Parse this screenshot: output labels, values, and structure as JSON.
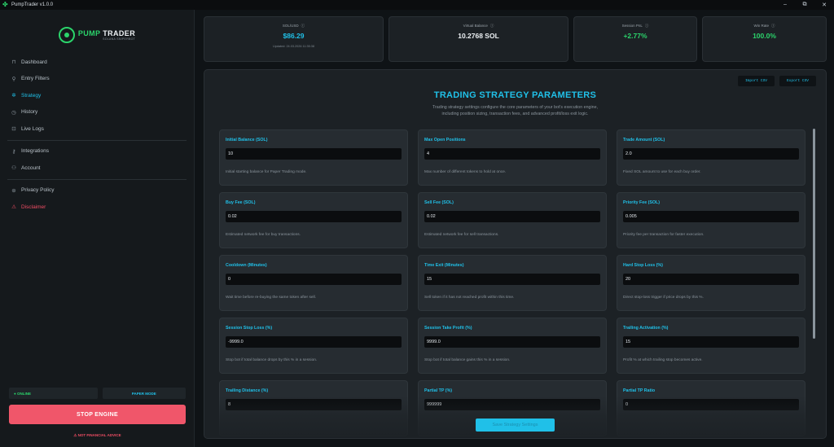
{
  "window": {
    "title": "PumpTrader v1.0.0",
    "controls": [
      "–",
      "⧉",
      "✕"
    ]
  },
  "brand": {
    "name_part1": "PUMP",
    "name_part2": " TRADER",
    "tagline": "SOLANA SNIPERBOT"
  },
  "sidebar": {
    "items": [
      {
        "label": "Dashboard",
        "icon": "dashboard-icon",
        "glyph": "⊓"
      },
      {
        "label": "Entry Filters",
        "icon": "filter-icon",
        "glyph": "⚲"
      },
      {
        "label": "Strategy",
        "icon": "gear-icon",
        "glyph": "✲"
      },
      {
        "label": "History",
        "icon": "clock-icon",
        "glyph": "◷"
      },
      {
        "label": "Live Logs",
        "icon": "log-icon",
        "glyph": "⊡"
      },
      {
        "label": "Integrations",
        "icon": "plug-icon",
        "glyph": "⚷"
      },
      {
        "label": "Account",
        "icon": "user-icon",
        "glyph": "⚇"
      },
      {
        "label": "Privacy Policy",
        "icon": "lock-icon",
        "glyph": "⊛"
      },
      {
        "label": "Disclaimer",
        "icon": "warning-icon",
        "glyph": "⚠"
      }
    ],
    "online_label": "● ONLINE",
    "mode_label": "PAPER MODE",
    "stop_label": "STOP ENGINE",
    "footer_note": "⚠ NOT FINANCIAL ADVICE"
  },
  "stats": [
    {
      "label": "SOL/USD",
      "value": "$86.29",
      "sub": "Updated: 24.03.2026 11:35:38"
    },
    {
      "label": "Virtual Balance",
      "value": "10.2768 SOL",
      "sub": ""
    },
    {
      "label": "Session PnL",
      "value": "+2.77%",
      "sub": ""
    },
    {
      "label": "Win Rate",
      "value": "100.0%",
      "sub": ""
    }
  ],
  "panel": {
    "import_label": "Import CSV",
    "export_label": "Export CSV",
    "title": "TRADING STRATEGY PARAMETERS",
    "desc_line1": "Trading strategy settings configure the core parameters of your bot's execution engine,",
    "desc_line2": "including position sizing, transaction fees, and advanced profit/loss exit logic.",
    "save_label": "Save Strategy Settings",
    "params": [
      {
        "label": "Initial Balance (SOL)",
        "value": "10",
        "help": "Initial starting balance for Paper Trading mode."
      },
      {
        "label": "Max Open Positions",
        "value": "4",
        "help": "Max number of different tokens to hold at once."
      },
      {
        "label": "Trade Amount (SOL)",
        "value": "2.0",
        "help": "Fixed SOL amount to use for each buy order."
      },
      {
        "label": "Buy Fee (SOL)",
        "value": "0.02",
        "help": "Estimated network fee for buy transactions."
      },
      {
        "label": "Sell Fee (SOL)",
        "value": "0.02",
        "help": "Estimated network fee for sell transactions."
      },
      {
        "label": "Priority Fee (SOL)",
        "value": "0.005",
        "help": "Priority fee per transaction for faster execution."
      },
      {
        "label": "Cooldown (Minutes)",
        "value": "0",
        "help": "Wait time before re-buying the same token after sell."
      },
      {
        "label": "Time Exit (Minutes)",
        "value": "15",
        "help": "Sell token if it has not reached profit within this time."
      },
      {
        "label": "Hard Stop Loss (%)",
        "value": "20",
        "help": "Direct stop-loss trigger if price drops by this %."
      },
      {
        "label": "Session Stop Loss (%)",
        "value": "-9999.0",
        "help": "Stop bot if total balance drops by this % in a session."
      },
      {
        "label": "Session Take Profit (%)",
        "value": "9999.0",
        "help": "Stop bot if total balance gains this % in a session."
      },
      {
        "label": "Trailing Activation (%)",
        "value": "15",
        "help": "Profit % at which trailing stop becomes active."
      },
      {
        "label": "Trailing Distance (%)",
        "value": "8",
        "help": ""
      },
      {
        "label": "Partial TP (%)",
        "value": "999999",
        "help": ""
      },
      {
        "label": "Partial TP Ratio",
        "value": "0",
        "help": ""
      }
    ]
  }
}
